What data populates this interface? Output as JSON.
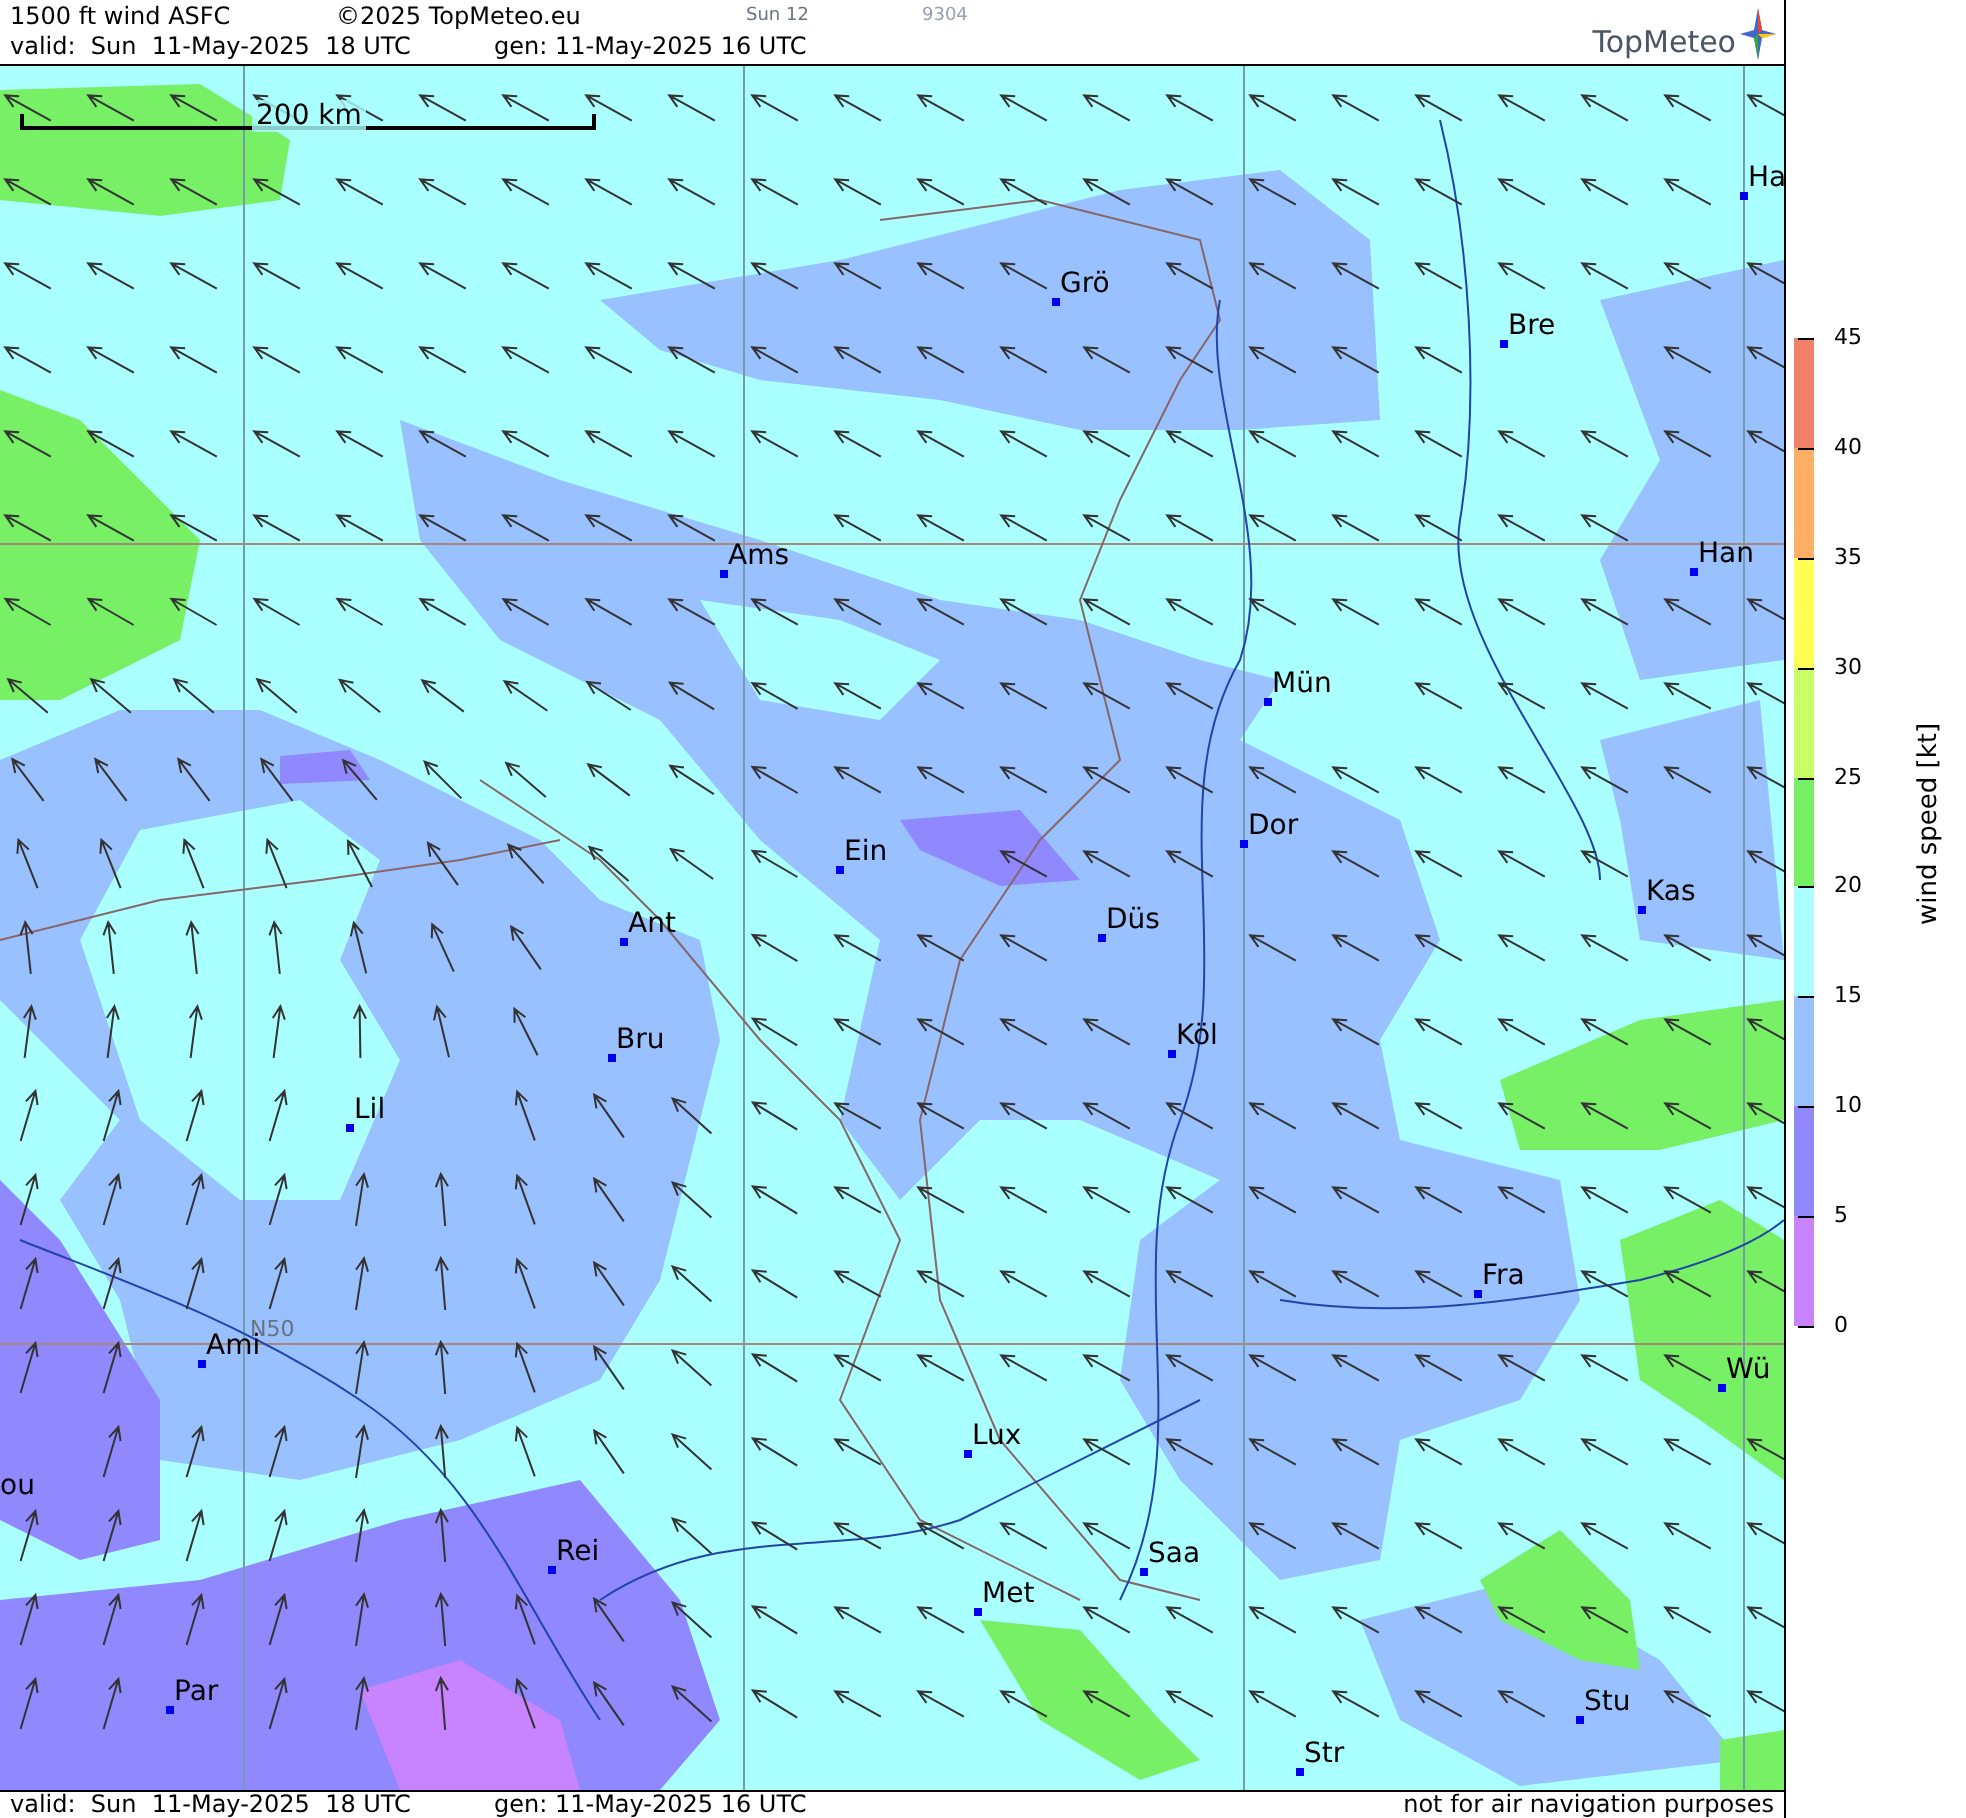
{
  "header": {
    "product": "1500 ft wind ASFC",
    "copyright": "©2025 TopMeteo.eu",
    "day": "Sun 12",
    "code": "9304",
    "valid": "valid:  Sun  11-May-2025  18 UTC",
    "generated": "gen: 11-May-2025 16 UTC"
  },
  "logo": {
    "text": "TopMeteo"
  },
  "map": {
    "scale": "200 km",
    "latitude_label": "N50",
    "cities": [
      "Ha",
      "Grö",
      "Bre",
      "Ams",
      "Han",
      "Mün",
      "Dor",
      "Ein",
      "Kas",
      "Düs",
      "Ant",
      "Köl",
      "Bru",
      "Lil",
      "Fra",
      "Ami",
      "Wü",
      "Lux",
      "ou",
      "Rei",
      "Saa",
      "Met",
      "Par",
      "Stu",
      "Str"
    ]
  },
  "legend": {
    "title": "wind speed [kt]",
    "ticks": [
      "45",
      "40",
      "35",
      "30",
      "25",
      "20",
      "15",
      "10",
      "5",
      "0"
    ],
    "bands": [
      {
        "color": "#f08066"
      },
      {
        "color": "#ffb066"
      },
      {
        "color": "#ffff55"
      },
      {
        "color": "#c8ff66"
      },
      {
        "color": "#77f066"
      },
      {
        "color": "#aaffff"
      },
      {
        "color": "#99c0ff"
      },
      {
        "color": "#8f88ff"
      },
      {
        "color": "#c884ff"
      }
    ]
  },
  "footer": {
    "valid": "valid:  Sun  11-May-2025  18 UTC",
    "generated": "gen: 11-May-2025 16 UTC",
    "notice": "not for air navigation purposes"
  }
}
